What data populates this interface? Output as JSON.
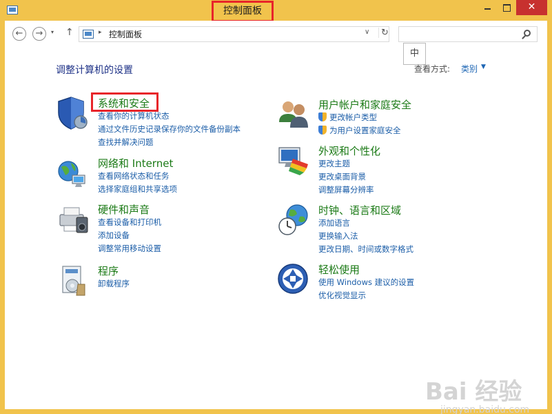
{
  "window": {
    "title": "控制面板",
    "close_glyph": "✕"
  },
  "nav": {
    "back_glyph": "←",
    "forward_glyph": "→",
    "recent_glyph": "▾",
    "up_glyph": "↑",
    "address_text": "控制面板",
    "address_sep": "▸",
    "dropdown_glyph": "∨",
    "refresh_glyph": "↻",
    "search_placeholder": ""
  },
  "ime": "中",
  "header": {
    "title": "调整计算机的设置",
    "view_by_label": "查看方式:",
    "view_by_value": "类别",
    "view_by_caret": "▼"
  },
  "categories": [
    {
      "title": "系统和安全",
      "icon": "system-security-icon",
      "links": [
        "查看你的计算机状态",
        "通过文件历史记录保存你的文件备份副本",
        "查找并解决问题"
      ]
    },
    {
      "title": "网络和 Internet",
      "icon": "network-icon",
      "links": [
        "查看网络状态和任务",
        "选择家庭组和共享选项"
      ]
    },
    {
      "title": "硬件和声音",
      "icon": "hardware-sound-icon",
      "links": [
        "查看设备和打印机",
        "添加设备",
        "调整常用移动设置"
      ]
    },
    {
      "title": "程序",
      "icon": "programs-icon",
      "links": [
        "卸载程序"
      ]
    },
    {
      "title": "用户帐户和家庭安全",
      "icon": "user-accounts-icon",
      "links": [
        "更改帐户类型",
        "为用户设置家庭安全"
      ]
    },
    {
      "title": "外观和个性化",
      "icon": "appearance-icon",
      "links": [
        "更改主题",
        "更改桌面背景",
        "调整屏幕分辨率"
      ]
    },
    {
      "title": "时钟、语言和区域",
      "icon": "clock-language-icon",
      "links": [
        "添加语言",
        "更换输入法",
        "更改日期、时间或数字格式"
      ]
    },
    {
      "title": "轻松使用",
      "icon": "ease-of-access-icon",
      "links": [
        "使用 Windows 建议的设置",
        "优化视觉显示"
      ]
    }
  ],
  "watermark": {
    "main": "Bai 经验",
    "sub": "jingyan.baidu.com"
  },
  "colors": {
    "frame": "#f1c34c",
    "link": "#1c5ea8",
    "category_title": "#1b7a16",
    "highlight": "#e8242a"
  }
}
